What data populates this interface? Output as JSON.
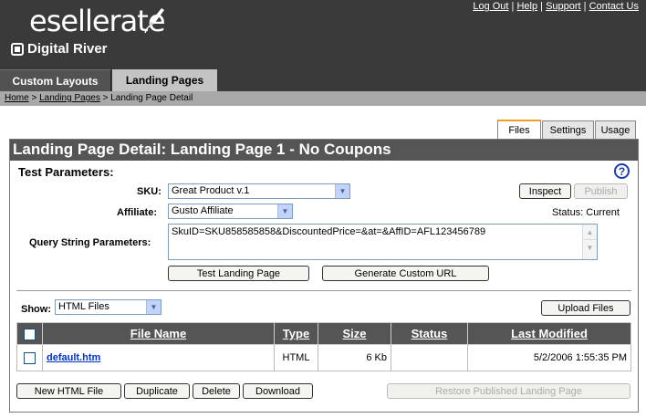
{
  "brand": {
    "name": "esellerate",
    "sub": "Digital River"
  },
  "top_links": [
    "Log Out",
    "Help",
    "Support",
    "Contact Us"
  ],
  "top_sep": "|",
  "main_tabs": [
    "Custom Layouts",
    "Landing Pages"
  ],
  "breadcrumb": {
    "home": "Home",
    "sep": ">",
    "landing": "Landing Pages",
    "current": "Landing Page Detail"
  },
  "sub_tabs": [
    "Files",
    "Settings",
    "Usage"
  ],
  "panel_title": "Landing Page Detail: Landing Page 1 - No Coupons",
  "test_params": {
    "heading": "Test Parameters:",
    "help": "?",
    "sku_label": "SKU:",
    "sku_value": "Great Product v.1",
    "affiliate_label": "Affiliate:",
    "affiliate_value": "Gusto Affiliate",
    "qs_label": "Query String Parameters:",
    "qs_value": "SkuID=SKU858585858&DiscountedPrice=&at=&AffID=AFL123456789",
    "inspect": "Inspect",
    "publish": "Publish",
    "status": "Status: Current",
    "test_button": "Test Landing Page",
    "generate_button": "Generate Custom URL"
  },
  "files": {
    "show_label": "Show:",
    "show_value": "HTML Files",
    "upload_button": "Upload Files",
    "columns": [
      "File Name",
      "Type",
      "Size",
      "Status",
      "Last Modified"
    ],
    "rows": [
      {
        "name": "default.htm",
        "type": "HTML",
        "size": "6 Kb",
        "status": "",
        "modified": "5/2/2006 1:55:35 PM"
      }
    ]
  },
  "actions": {
    "new_file": "New HTML File",
    "duplicate": "Duplicate",
    "delete": "Delete",
    "download": "Download",
    "restore": "Restore Published Landing Page"
  }
}
